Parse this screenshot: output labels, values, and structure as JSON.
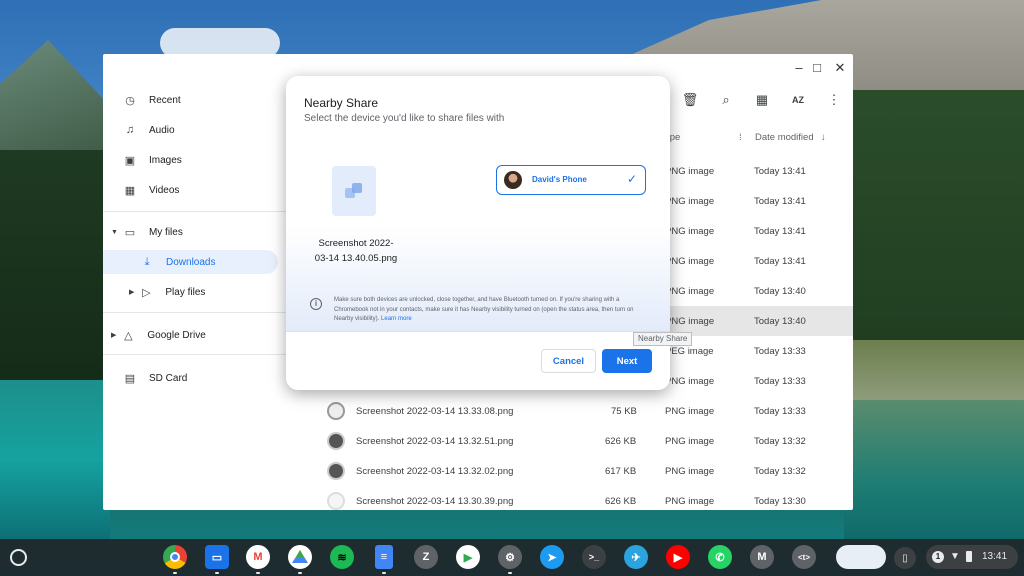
{
  "window": {
    "minimize": "–",
    "maximize": "□",
    "close": "✕"
  },
  "sidebar": {
    "items": [
      {
        "label": "Recent",
        "icon": "clock-icon"
      },
      {
        "label": "Audio",
        "icon": "headphones-icon"
      },
      {
        "label": "Images",
        "icon": "image-icon"
      },
      {
        "label": "Videos",
        "icon": "film-icon"
      },
      {
        "label": "My files",
        "icon": "laptop-icon"
      },
      {
        "label": "Downloads",
        "icon": "download-icon"
      },
      {
        "label": "Play files",
        "icon": "play-store-icon"
      },
      {
        "label": "Google Drive",
        "icon": "drive-icon"
      },
      {
        "label": "SD Card",
        "icon": "sd-card-icon"
      }
    ]
  },
  "columns": {
    "type": "ype",
    "date": "Date modified"
  },
  "files": [
    {
      "name": "",
      "size": "",
      "type": "PNG image",
      "date": "Today 13:41"
    },
    {
      "name": "",
      "size": "",
      "type": "PNG image",
      "date": "Today 13:41"
    },
    {
      "name": "",
      "size": "",
      "type": "PNG image",
      "date": "Today 13:41"
    },
    {
      "name": "",
      "size": "",
      "type": "PNG image",
      "date": "Today 13:41"
    },
    {
      "name": "",
      "size": "",
      "type": "PNG image",
      "date": "Today 13:40"
    },
    {
      "name": "",
      "size": "",
      "type": "PNG image",
      "date": "Today 13:40"
    },
    {
      "name": "",
      "size": "",
      "type": "PEG image",
      "date": "Today 13:33"
    },
    {
      "name": "",
      "size": "",
      "type": "PNG image",
      "date": "Today 13:33"
    },
    {
      "name": "Screenshot 2022-03-14 13.33.08.png",
      "size": "75 KB",
      "type": "PNG image",
      "date": "Today 13:33"
    },
    {
      "name": "Screenshot 2022-03-14 13.32.51.png",
      "size": "626 KB",
      "type": "PNG image",
      "date": "Today 13:32"
    },
    {
      "name": "Screenshot 2022-03-14 13.32.02.png",
      "size": "617 KB",
      "type": "PNG image",
      "date": "Today 13:32"
    },
    {
      "name": "Screenshot 2022-03-14 13.30.39.png",
      "size": "626 KB",
      "type": "PNG image",
      "date": "Today 13:30"
    }
  ],
  "dialog": {
    "title": "Nearby Share",
    "subtitle": "Select the device you'd like to share files with",
    "file_line1": "Screenshot 2022-",
    "file_line2": "03-14 13.40.05.png",
    "device": "David's Phone",
    "info": "Make sure both devices are unlocked, close together, and have Bluetooth turned on. If you're sharing with a Chromebook not in your contacts, make sure it has Nearby visibility turned on (open the status area, then turn on Nearby visibility).",
    "info_link": "Learn more",
    "cancel": "Cancel",
    "next": "Next"
  },
  "tooltip": "Nearby Share",
  "shelf": {
    "apps": [
      {
        "icon": "chrome-icon",
        "letter": "",
        "color": "#ea4335"
      },
      {
        "icon": "files-icon",
        "letter": "",
        "color": "#1a73e8"
      },
      {
        "icon": "gmail-icon",
        "letter": "M",
        "color": "#ffffff"
      },
      {
        "icon": "drive-icon",
        "letter": "",
        "color": "#fbbc04"
      },
      {
        "icon": "spotify-icon",
        "letter": "",
        "color": "#1db954"
      },
      {
        "icon": "docs-icon",
        "letter": "",
        "color": "#4285f4"
      },
      {
        "icon": "zoom-icon",
        "letter": "Z",
        "color": "#5f6368"
      },
      {
        "icon": "play-store-icon",
        "letter": "▶",
        "color": "#ffffff"
      },
      {
        "icon": "settings-icon",
        "letter": "⚙",
        "color": "#5f6368"
      },
      {
        "icon": "twitter-icon",
        "letter": "",
        "color": "#1d9bf0"
      },
      {
        "icon": "terminal-icon",
        "letter": ">_",
        "color": "#3c4043"
      },
      {
        "icon": "telegram-icon",
        "letter": "",
        "color": "#2aa3df"
      },
      {
        "icon": "youtube-icon",
        "letter": "▶",
        "color": "#ff0000"
      },
      {
        "icon": "whatsapp-icon",
        "letter": "",
        "color": "#25d366"
      },
      {
        "icon": "mail-icon",
        "letter": "M",
        "color": "#5f6368"
      },
      {
        "icon": "code-icon",
        "letter": "<t>",
        "color": "#5f6368"
      }
    ],
    "notifications": "1",
    "time": "13:41"
  }
}
